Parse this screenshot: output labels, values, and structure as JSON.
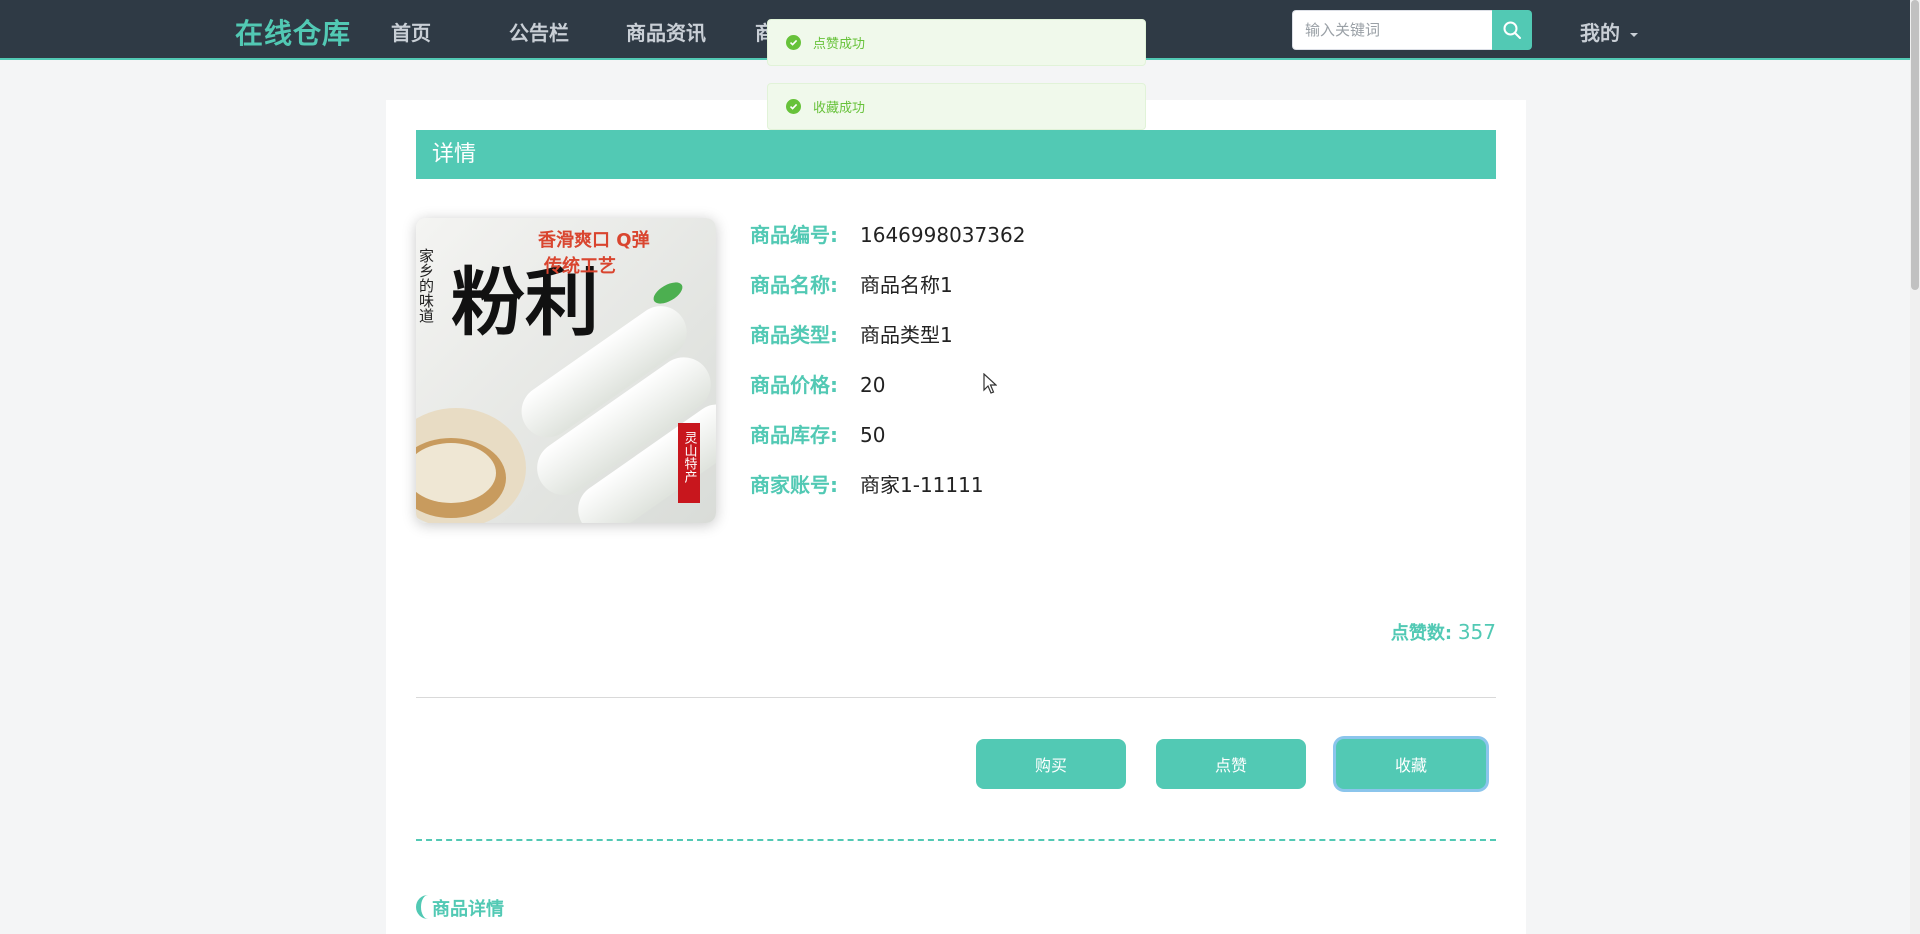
{
  "nav": {
    "brand": "在线仓库",
    "items": [
      "首页",
      "公告栏",
      "商品资讯",
      "商"
    ],
    "search_placeholder": "输入关键词",
    "user_menu": "我的"
  },
  "detail": {
    "header": "详情",
    "fields": [
      {
        "label": "商品编号:",
        "value": "1646998037362"
      },
      {
        "label": "商品名称:",
        "value": "商品名称1"
      },
      {
        "label": "商品类型:",
        "value": "商品类型1"
      },
      {
        "label": "商品价格:",
        "value": "20"
      },
      {
        "label": "商品库存:",
        "value": "50"
      },
      {
        "label": "商家账号:",
        "value": "商家1-11111"
      }
    ],
    "likes_label": "点赞数:",
    "likes_value": "357",
    "buttons": {
      "buy": "购买",
      "like": "点赞",
      "favorite": "收藏"
    },
    "description_title": "商品详情"
  },
  "product_image_text": {
    "title": "粉利",
    "side": "家乡的味道",
    "slogan_line1": "香滑爽口 Q弹",
    "slogan_line2": "传统工艺",
    "stamp": "灵山特产"
  },
  "toasts": [
    "点赞成功",
    "收藏成功"
  ],
  "colors": {
    "accent": "#52c9b4",
    "nav_bg": "#2f3a45",
    "toast_bg": "#f0f9eb",
    "toast_text": "#67c23a"
  }
}
